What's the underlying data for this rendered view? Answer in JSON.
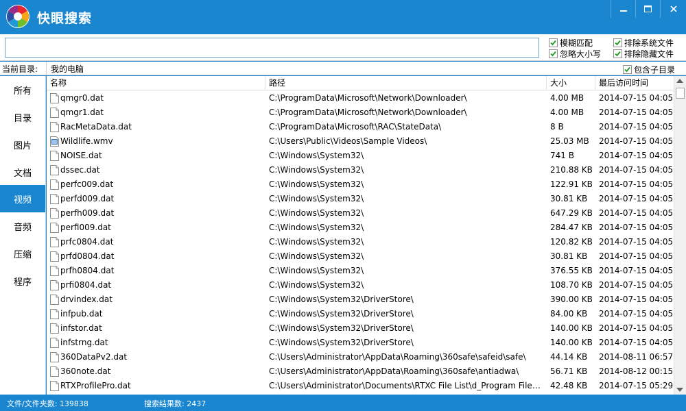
{
  "app": {
    "title": "快眼搜索",
    "colors": {
      "accent": "#1a86d0",
      "active_bg": "#1a86d0"
    }
  },
  "search": {
    "value": "",
    "placeholder": ""
  },
  "options": {
    "fuzzy": {
      "label": "模糊匹配",
      "checked": true
    },
    "ignore_case": {
      "label": "忽略大小写",
      "checked": true
    },
    "exclude_system": {
      "label": "排除系统文件",
      "checked": true
    },
    "exclude_hidden": {
      "label": "排除隐藏文件",
      "checked": true
    },
    "include_subdirs": {
      "label": "包含子目录",
      "checked": true
    }
  },
  "directory": {
    "label": "当前目录:",
    "value": "我的电脑"
  },
  "sidebar": {
    "items": [
      {
        "label": "所有"
      },
      {
        "label": "目录"
      },
      {
        "label": "图片"
      },
      {
        "label": "文档"
      },
      {
        "label": "视频",
        "active": true
      },
      {
        "label": "音频"
      },
      {
        "label": "压缩"
      },
      {
        "label": "程序"
      }
    ]
  },
  "table": {
    "headers": {
      "name": "名称",
      "path": "路径",
      "size": "大小",
      "time": "最后访问时间"
    },
    "rows": [
      {
        "icon": "file-icon",
        "name": "qmgr0.dat",
        "path": "C:\\ProgramData\\Microsoft\\Network\\Downloader\\",
        "size": "4.00 MB",
        "time": "2014-07-15 04:05"
      },
      {
        "icon": "file-icon",
        "name": "qmgr1.dat",
        "path": "C:\\ProgramData\\Microsoft\\Network\\Downloader\\",
        "size": "4.00 MB",
        "time": "2014-07-15 04:05"
      },
      {
        "icon": "file-icon",
        "name": "RacMetaData.dat",
        "path": "C:\\ProgramData\\Microsoft\\RAC\\StateData\\",
        "size": "8 B",
        "time": "2014-07-15 04:05"
      },
      {
        "icon": "video-file-icon",
        "name": "Wildlife.wmv",
        "path": "C:\\Users\\Public\\Videos\\Sample Videos\\",
        "size": "25.03 MB",
        "time": "2014-07-15 04:05"
      },
      {
        "icon": "file-icon",
        "name": "NOISE.dat",
        "path": "C:\\Windows\\System32\\",
        "size": "741 B",
        "time": "2014-07-15 04:05"
      },
      {
        "icon": "file-icon",
        "name": "dssec.dat",
        "path": "C:\\Windows\\System32\\",
        "size": "210.88 KB",
        "time": "2014-07-15 04:05"
      },
      {
        "icon": "file-icon",
        "name": "perfc009.dat",
        "path": "C:\\Windows\\System32\\",
        "size": "122.91 KB",
        "time": "2014-07-15 04:05"
      },
      {
        "icon": "file-icon",
        "name": "perfd009.dat",
        "path": "C:\\Windows\\System32\\",
        "size": "30.81 KB",
        "time": "2014-07-15 04:05"
      },
      {
        "icon": "file-icon",
        "name": "perfh009.dat",
        "path": "C:\\Windows\\System32\\",
        "size": "647.29 KB",
        "time": "2014-07-15 04:05"
      },
      {
        "icon": "file-icon",
        "name": "perfi009.dat",
        "path": "C:\\Windows\\System32\\",
        "size": "284.47 KB",
        "time": "2014-07-15 04:05"
      },
      {
        "icon": "file-icon",
        "name": "prfc0804.dat",
        "path": "C:\\Windows\\System32\\",
        "size": "120.82 KB",
        "time": "2014-07-15 04:05"
      },
      {
        "icon": "file-icon",
        "name": "prfd0804.dat",
        "path": "C:\\Windows\\System32\\",
        "size": "30.81 KB",
        "time": "2014-07-15 04:05"
      },
      {
        "icon": "file-icon",
        "name": "prfh0804.dat",
        "path": "C:\\Windows\\System32\\",
        "size": "376.55 KB",
        "time": "2014-07-15 04:05"
      },
      {
        "icon": "file-icon",
        "name": "prfi0804.dat",
        "path": "C:\\Windows\\System32\\",
        "size": "108.70 KB",
        "time": "2014-07-15 04:05"
      },
      {
        "icon": "file-icon",
        "name": "drvindex.dat",
        "path": "C:\\Windows\\System32\\DriverStore\\",
        "size": "390.00 KB",
        "time": "2014-07-15 04:05"
      },
      {
        "icon": "file-icon",
        "name": "infpub.dat",
        "path": "C:\\Windows\\System32\\DriverStore\\",
        "size": "84.00 KB",
        "time": "2014-07-15 04:05"
      },
      {
        "icon": "file-icon",
        "name": "infstor.dat",
        "path": "C:\\Windows\\System32\\DriverStore\\",
        "size": "140.00 KB",
        "time": "2014-07-15 04:05"
      },
      {
        "icon": "file-icon",
        "name": "infstrng.dat",
        "path": "C:\\Windows\\System32\\DriverStore\\",
        "size": "140.00 KB",
        "time": "2014-07-15 04:05"
      },
      {
        "icon": "file-icon",
        "name": "360DataPv2.dat",
        "path": "C:\\Users\\Administrator\\AppData\\Roaming\\360safe\\safeid\\safe\\",
        "size": "44.14 KB",
        "time": "2014-08-11 06:57"
      },
      {
        "icon": "file-icon",
        "name": "360note.dat",
        "path": "C:\\Users\\Administrator\\AppData\\Roaming\\360safe\\antiadwa\\",
        "size": "56.71 KB",
        "time": "2014-08-12 00:15"
      },
      {
        "icon": "file-icon",
        "name": "RTXProfilePro.dat",
        "path": "C:\\Users\\Administrator\\Documents\\RTXC File List\\d_Program Files_...",
        "size": "42.48 KB",
        "time": "2014-07-15 05:29"
      }
    ]
  },
  "status": {
    "files": "文件/文件夹数: 139838",
    "results": "搜索结果数: 2437"
  }
}
